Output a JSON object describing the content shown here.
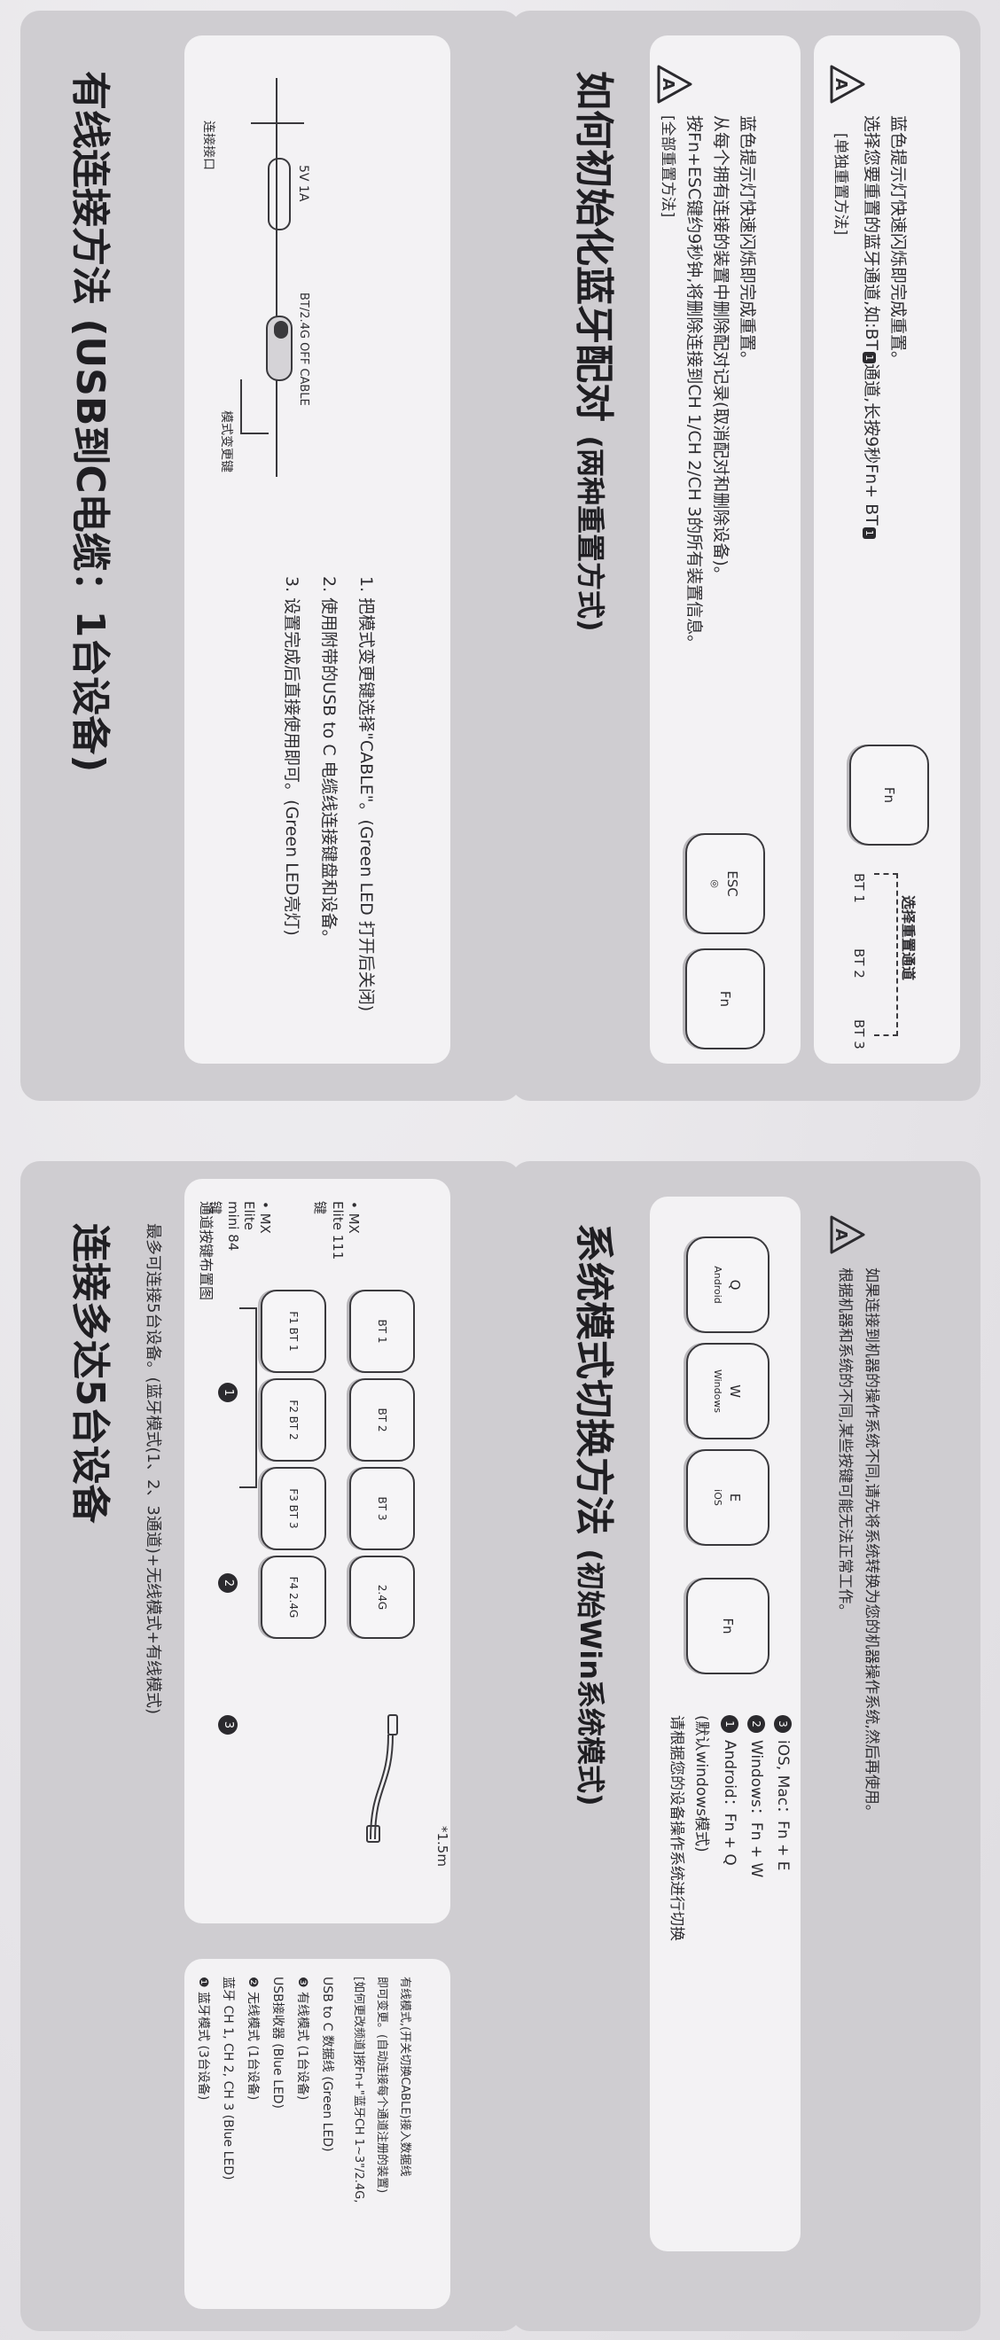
{
  "wired": {
    "title": "有线连接方法 (USB到C电缆：1台设备)",
    "port_label": "连接接口",
    "power_label": "5V 1A",
    "mode_switch_label": "模式变更键",
    "switch_positions": "BT/2.4G   OFF   CABLE",
    "steps": [
      "1. 把模式变更键选择\"CABLE\"。(Green LED 打开后关闭)",
      "2. 使用附带的USB to C 电缆线连接键盘和设备。",
      "3. 设置完成后直接使用即可。(Green LED亮灯)"
    ]
  },
  "reset": {
    "title": "如何初始化蓝牙配对",
    "title_suffix": "(两种重置方式)",
    "all": {
      "header": "[全部重置方法]",
      "lines": [
        "按Fn+ESC键约9秒钟,将删除连接到CH 1/CH 2/CH 3的所有装置信息。",
        "从每个拥有连接的装置中删除配对记录(取消配对和删除设备)。",
        "蓝色提示灯快速闪烁即完成重置。"
      ],
      "key_esc": "ESC",
      "key_fn": "Fn"
    },
    "single": {
      "header": "[单独重置方法]",
      "line1_pre": "选择您要重置的蓝牙通道,如:BT",
      "line1_mid": "通道,长按9秒Fn+ BT",
      "line2": "蓝色提示灯快速闪烁即完成重置。",
      "key_fn": "Fn",
      "bt_keys": [
        "BT 1",
        "BT 2",
        "BT 3"
      ],
      "channel_label": "选择重置通道"
    }
  },
  "multi": {
    "title": "连接多达5台设备",
    "desc": "最多可连接5台设备。(蓝牙模式(1、2、3通道)+无线模式+有线模式)",
    "layout_label": "通道按键布置图",
    "models": [
      "• MX Elite mini 84键",
      "• MX Elite 111键"
    ],
    "row1_keys": [
      "F1 BT 1",
      "F2 BT 2",
      "F3 BT 3",
      "F4 2.4G"
    ],
    "row2_keys": [
      "BT 1",
      "BT 2",
      "BT 3",
      "2.4G"
    ],
    "cable_length": "*1.5m",
    "badges": [
      "1",
      "2",
      "3"
    ],
    "modes": [
      "❶ 蓝牙模式 (3台设备)",
      "蓝牙 CH 1, CH 2, CH 3 (Blue LED)",
      "❷ 无线模式 (1台设备)",
      "USB接收器 (Blue LED)",
      "❸ 有线模式 (1台设备)",
      "USB to C 数据线 (Green LED)",
      "[如何更改频道]按Fn+\"蓝牙CH 1~3\"/2.4G,",
      "即可变更。(自动连接每个通道注册的装置)",
      "有线模式,(开关切换CABLE)接入数据线"
    ]
  },
  "os": {
    "title": "系统模式切换方法",
    "title_suffix": "(初始Win系统模式)",
    "keys": [
      {
        "label": "Q",
        "sub": "Android"
      },
      {
        "label": "W",
        "sub": "Windows"
      },
      {
        "label": "E",
        "sub": "iOS"
      },
      {
        "label": "Fn",
        "sub": ""
      }
    ],
    "instructions": [
      "请根据您的设备操作系统进行切换",
      "(默认windows模式)"
    ],
    "options": [
      {
        "n": "1",
        "text": "Android：Fn + Q"
      },
      {
        "n": "2",
        "text": "Windows：Fn + W"
      },
      {
        "n": "3",
        "text": "iOS, Mac：Fn + E"
      }
    ],
    "warning": [
      "根据机器和系统的不同,某些按键可能无法正常工作。",
      "如果连接到机器的操作系统不同,请先将系统转换为您的机器操作系统,然后再使用。"
    ]
  }
}
